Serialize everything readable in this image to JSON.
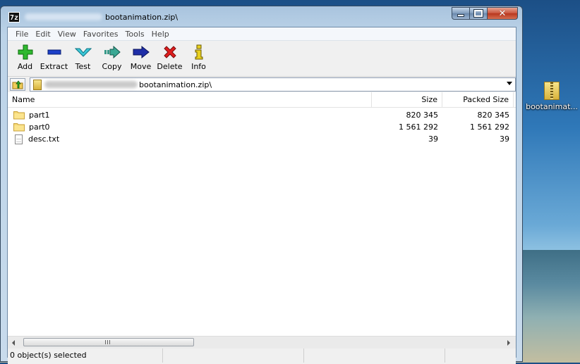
{
  "window": {
    "title": "bootanimation.zip\\",
    "app_icon": "7z",
    "accent": "#4a6d94"
  },
  "menu": [
    "File",
    "Edit",
    "View",
    "Favorites",
    "Tools",
    "Help"
  ],
  "toolbar": [
    {
      "label": "Add",
      "icon": "plus-icon",
      "color": "#1a9c1a"
    },
    {
      "label": "Extract",
      "icon": "minus-icon",
      "color": "#1636b4"
    },
    {
      "label": "Test",
      "icon": "check-chevron-icon",
      "color": "#18a6b8"
    },
    {
      "label": "Copy",
      "icon": "arrow-copy-icon",
      "color": "#2a8a7a"
    },
    {
      "label": "Move",
      "icon": "arrow-move-icon",
      "color": "#1a2a9a"
    },
    {
      "label": "Delete",
      "icon": "x-icon",
      "color": "#d81818"
    },
    {
      "label": "Info",
      "icon": "info-icon",
      "color": "#c8b000"
    }
  ],
  "address": {
    "path": "bootanimation.zip\\"
  },
  "columns": {
    "name": "Name",
    "size": "Size",
    "packed": "Packed Size"
  },
  "files": [
    {
      "name": "part1",
      "type": "folder",
      "size": "820 345",
      "packed": "820 345"
    },
    {
      "name": "part0",
      "type": "folder",
      "size": "1 561 292",
      "packed": "1 561 292"
    },
    {
      "name": "desc.txt",
      "type": "file",
      "size": "39",
      "packed": "39"
    }
  ],
  "scrollbar": {
    "grip": "|||"
  },
  "status": {
    "selection": "0 object(s) selected",
    "cell2": "",
    "cell3": ""
  },
  "desktop": {
    "icon_label": "bootanimat..."
  }
}
